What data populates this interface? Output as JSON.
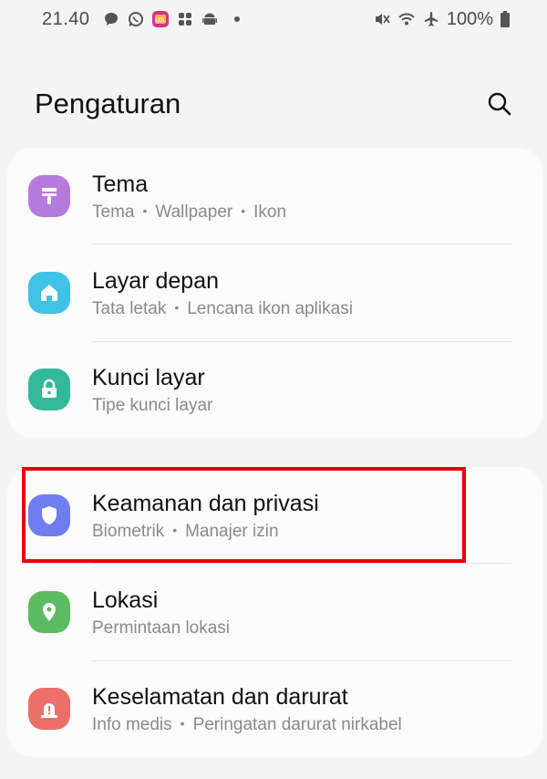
{
  "status_bar": {
    "time": "21.40",
    "battery": "100%",
    "left_icons": [
      "chat-bubble-icon",
      "whatsapp-icon",
      "app-badge-icon",
      "slack-icon",
      "android-icon",
      "notification-dot"
    ],
    "right_icons": [
      "mute-icon",
      "wifi-icon",
      "airplane-icon",
      "battery-icon"
    ]
  },
  "header": {
    "title": "Pengaturan",
    "search_icon": "search-icon"
  },
  "groups": [
    {
      "items": [
        {
          "title": "Tema",
          "subtitle": [
            "Tema",
            "Wallpaper",
            "Ikon"
          ],
          "icon": "theme-brush-icon",
          "color": "#b57bdc"
        },
        {
          "title": "Layar depan",
          "subtitle": [
            "Tata letak",
            "Lencana ikon aplikasi"
          ],
          "icon": "home-icon",
          "color": "#3fc2e6"
        },
        {
          "title": "Kunci layar",
          "subtitle": [
            "Tipe kunci layar"
          ],
          "icon": "lock-icon",
          "color": "#34b89b"
        }
      ]
    },
    {
      "items": [
        {
          "title": "Keamanan dan privasi",
          "subtitle": [
            "Biometrik",
            "Manajer izin"
          ],
          "icon": "shield-icon",
          "color": "#6f7df0"
        },
        {
          "title": "Lokasi",
          "subtitle": [
            "Permintaan lokasi"
          ],
          "icon": "location-pin-icon",
          "color": "#5dbb63"
        },
        {
          "title": "Keselamatan dan darurat",
          "subtitle": [
            "Info medis",
            "Peringatan darurat nirkabel"
          ],
          "icon": "emergency-icon",
          "color": "#ec6f69"
        }
      ]
    }
  ],
  "highlight": {
    "target": "Keamanan dan privasi",
    "color": "#e8000b"
  }
}
